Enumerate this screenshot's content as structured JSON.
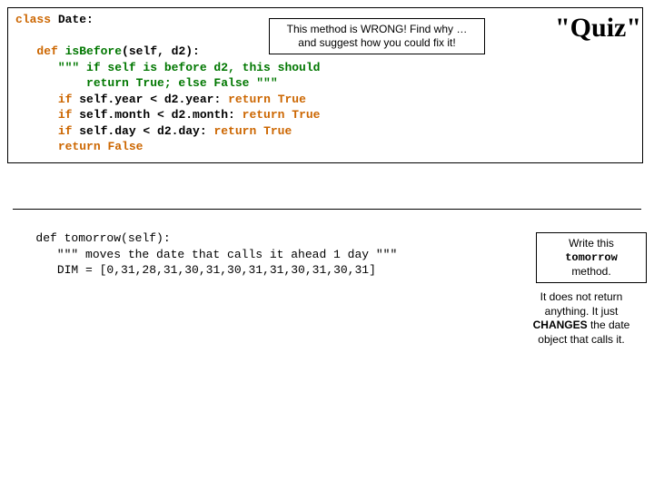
{
  "quiz_title": "\"Quiz\"",
  "callout1_line1": "This method is WRONG! Find why …",
  "callout1_line2": "and suggest how you could fix it!",
  "callout2_line1": "Write this",
  "callout2_mono": "tomorrow",
  "callout2_line2_rest": " method.",
  "note_pre": "It does not return anything. It just ",
  "note_bold": "CHANGES",
  "note_post": " the date object that calls it.",
  "code1": {
    "l1_kw": "class",
    "l1_name": " Date:",
    "l2_indent": "   ",
    "l2_kw": "def",
    "l2_sp": " ",
    "l2_fn": "isBefore",
    "l2_args": "(self, d2):",
    "l3": "      \"\"\" if self is before d2, this should",
    "l4": "          return True; else False \"\"\"",
    "l5_indent": "      ",
    "l5_kw": "if",
    "l5_cond": " self.year < d2.year: ",
    "l5_ret": "return",
    "l5_sp": " ",
    "l5_val": "True",
    "l6_indent": "      ",
    "l6_kw": "if",
    "l6_cond": " self.month < d2.month: ",
    "l6_ret": "return",
    "l6_sp": " ",
    "l6_val": "True",
    "l7_indent": "      ",
    "l7_kw": "if",
    "l7_cond": " self.day < d2.day: ",
    "l7_ret": "return",
    "l7_sp": " ",
    "l7_val": "True",
    "l8_indent": "      ",
    "l8_ret": "return",
    "l8_sp": " ",
    "l8_val": "False"
  },
  "code2": {
    "l1_indent": "   ",
    "l1_kw": "def",
    "l1_sp": " ",
    "l1_fn": "tomorrow",
    "l1_args": "(self):",
    "l2": "      \"\"\" moves the date that calls it ahead 1 day \"\"\"",
    "l3_indent": "      ",
    "l3_var": "DIM = ",
    "l3_list": "[0,31,28,31,30,31,30,31,31,30,31,30,31]"
  }
}
